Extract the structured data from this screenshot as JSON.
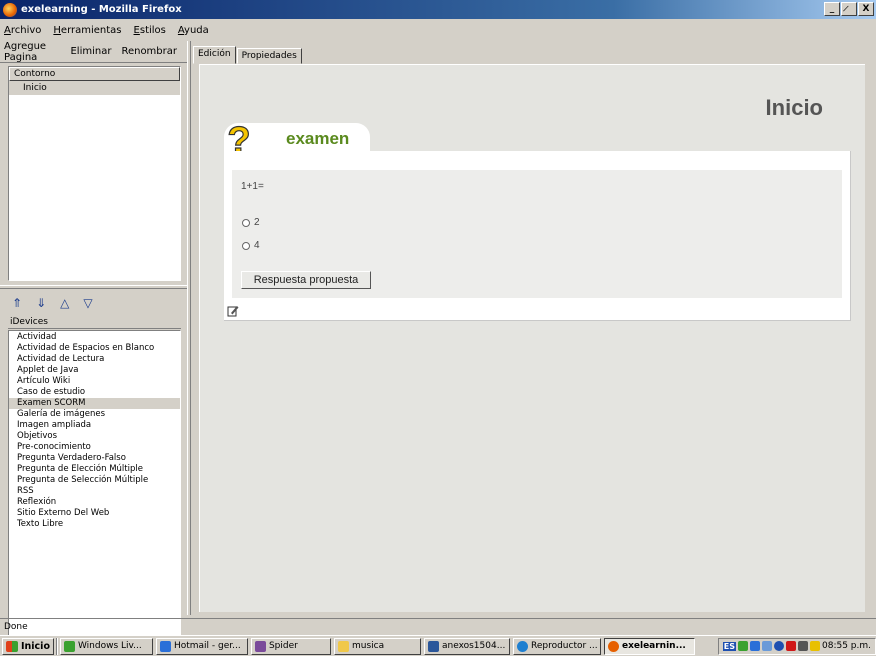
{
  "window": {
    "title": "exelearning - Mozilla Firefox",
    "controls": [
      "_",
      "̷",
      "X"
    ]
  },
  "menu": {
    "items": [
      "Archivo",
      "Herramientas",
      "Estilos",
      "Ayuda"
    ]
  },
  "outline": {
    "toolbar": [
      "Agregue Pagina",
      "Eliminar",
      "Renombrar"
    ],
    "header": "Contorno",
    "nodes": [
      "Inicio"
    ]
  },
  "nav_arrows": [
    "⇑",
    "⇓",
    "△",
    "▽"
  ],
  "idevices": {
    "header": "iDevices",
    "items": [
      "Actividad",
      "Actividad de Espacios en Blanco",
      "Actividad de Lectura",
      "Applet de Java",
      "Artículo Wiki",
      "Caso de estudio",
      "Examen SCORM",
      "Galería de imágenes",
      "Imagen ampliada",
      "Objetivos",
      "Pre-conocimiento",
      "Pregunta Verdadero-Falso",
      "Pregunta de Elección Múltiple",
      "Pregunta de Selección Múltiple",
      "RSS",
      "Reflexión",
      "Sitio Externo Del Web",
      "Texto Libre"
    ],
    "selected": "Examen SCORM"
  },
  "tabs": [
    "Edición",
    "Propiedades"
  ],
  "page": {
    "title": "Inicio",
    "idevice": {
      "icon": "question-mark-icon",
      "title": "examen",
      "question": "1+1=",
      "options": [
        "2",
        "4"
      ],
      "button": "Respuesta propuesta"
    }
  },
  "status": "Done",
  "taskbar": {
    "start": "Inicio",
    "tasks": [
      {
        "label": "Windows Liv...",
        "icon": "messenger-icon",
        "active": false
      },
      {
        "label": "Hotmail - ger...",
        "icon": "ie-icon",
        "active": false
      },
      {
        "label": "Spider",
        "icon": "spider-icon",
        "active": false
      },
      {
        "label": "musica",
        "icon": "folder-icon",
        "active": false
      },
      {
        "label": "anexos1504...",
        "icon": "word-icon",
        "active": false
      },
      {
        "label": "Reproductor ...",
        "icon": "media-player-icon",
        "active": false
      },
      {
        "label": "exelearnin...",
        "icon": "firefox-icon",
        "active": true
      }
    ],
    "lang": "ES",
    "clock": "08:55 p.m."
  },
  "colors": {
    "title_bar": "#0a246a",
    "idevice_title": "#5a8a1e",
    "question_icon": "#f5c400"
  }
}
